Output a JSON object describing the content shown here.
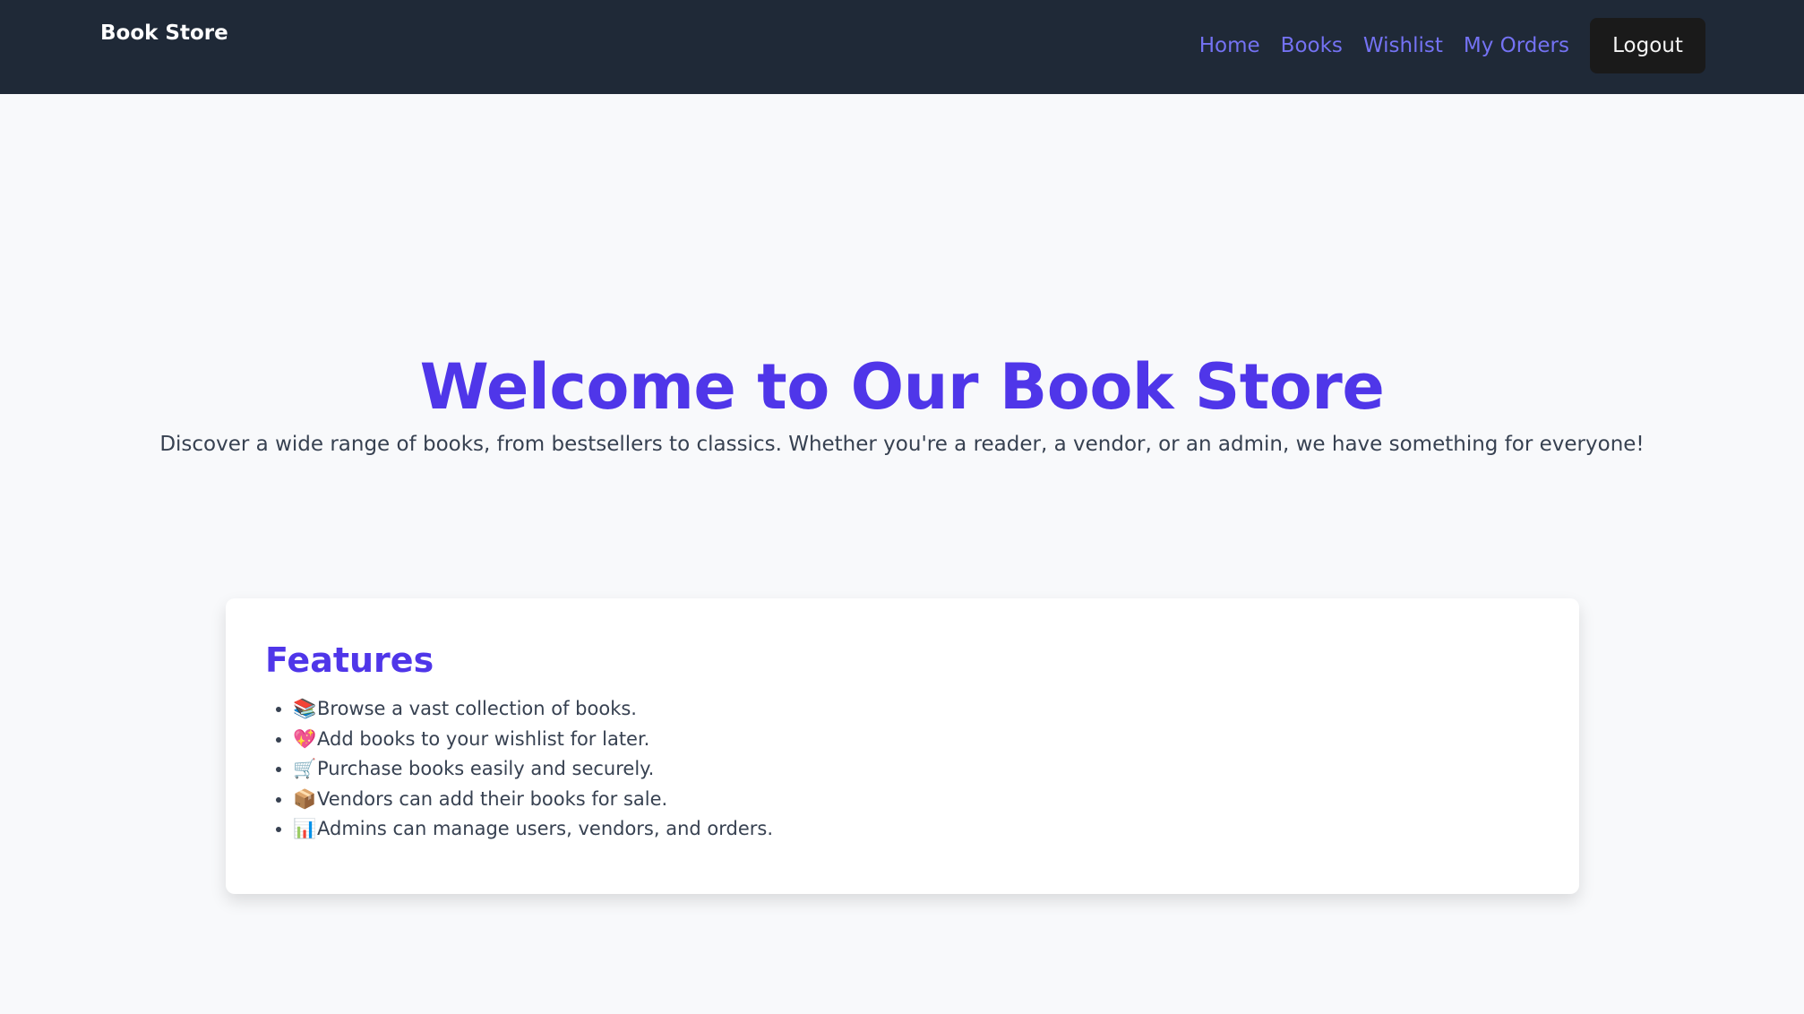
{
  "header": {
    "brand": "Book Store",
    "nav": [
      {
        "label": "Home"
      },
      {
        "label": "Books"
      },
      {
        "label": "Wishlist"
      },
      {
        "label": "My Orders"
      }
    ],
    "logout_label": "Logout"
  },
  "hero": {
    "title": "Welcome to Our Book Store",
    "subtitle": "Discover a wide range of books, from bestsellers to classics. Whether you're a reader, a vendor, or an admin, we have something for everyone!"
  },
  "features": {
    "title": "Features",
    "items": [
      {
        "icon": "📚",
        "text": "Browse a vast collection of books."
      },
      {
        "icon": "💖",
        "text": "Add books to your wishlist for later."
      },
      {
        "icon": "🛒",
        "text": "Purchase books easily and securely."
      },
      {
        "icon": "📦",
        "text": "Vendors can add their books for sale."
      },
      {
        "icon": "📊",
        "text": "Admins can manage users, vendors, and orders."
      }
    ]
  },
  "colors": {
    "navbar_background": "#1f2937",
    "accent": "#4f36e9",
    "nav_link": "#7472f3",
    "page_background": "#f8f9fb"
  }
}
